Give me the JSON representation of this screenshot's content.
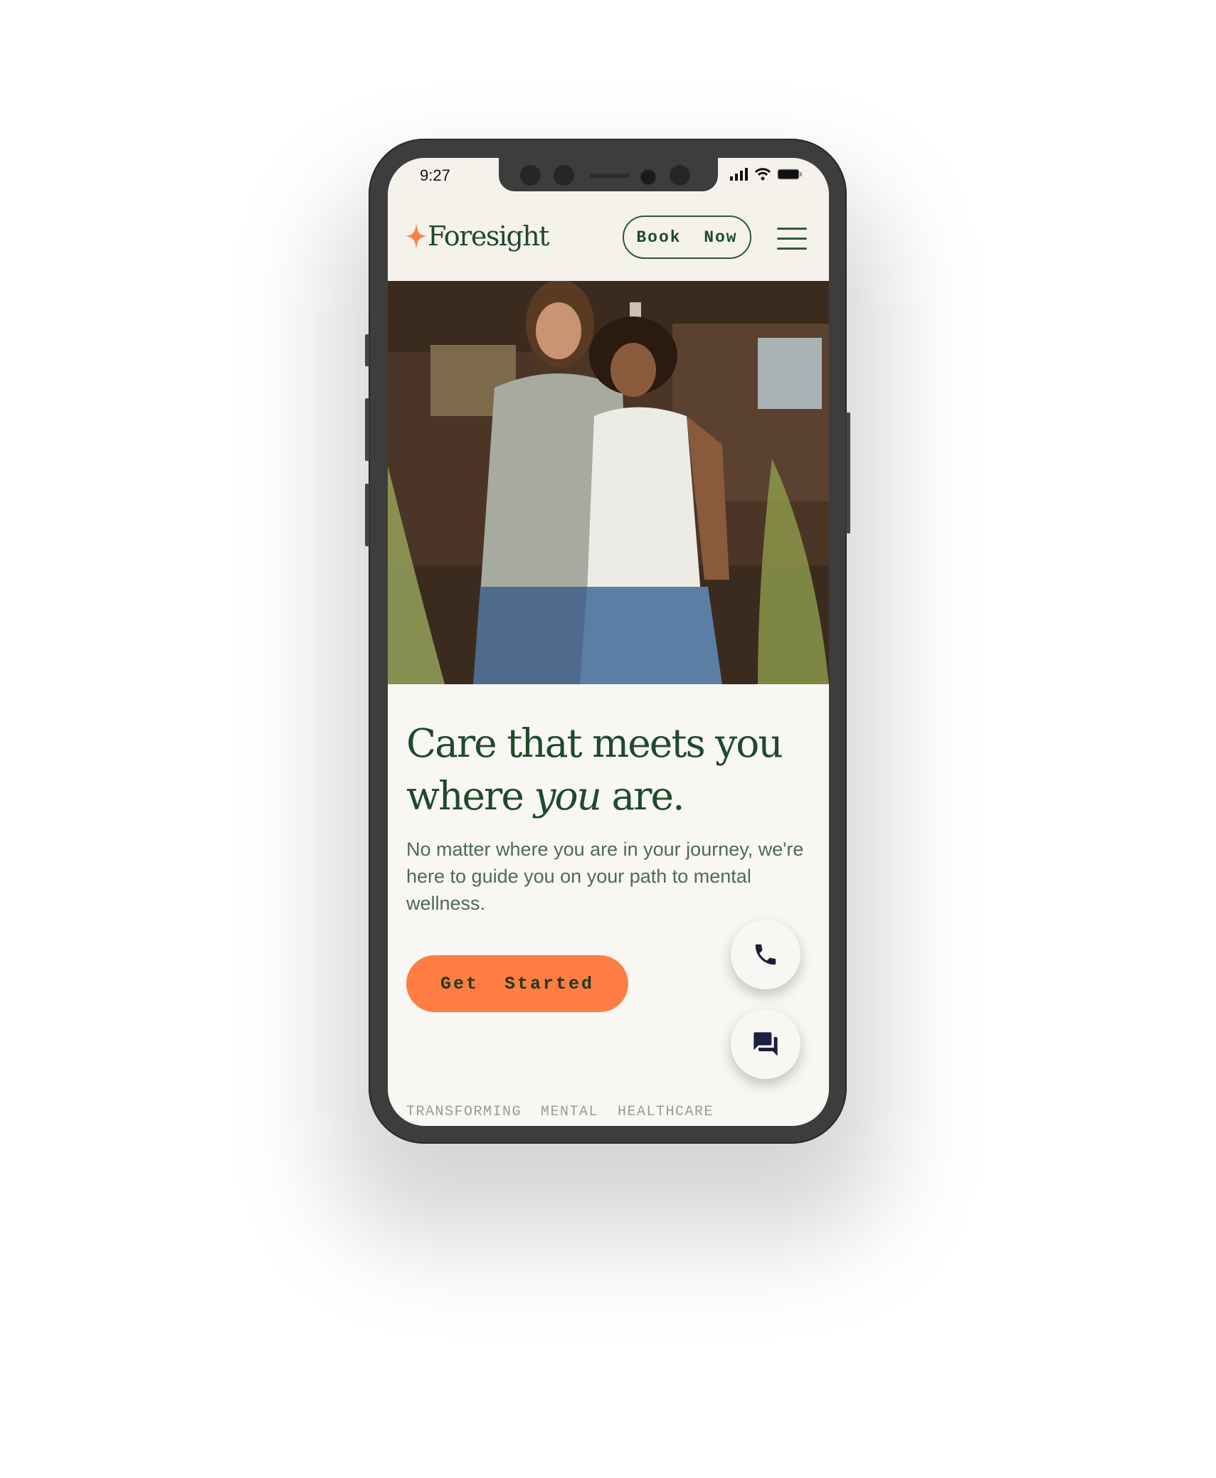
{
  "status_bar": {
    "time": "9:27"
  },
  "header": {
    "logo_text": "Foresight",
    "book_now_label": "Book  Now",
    "menu_icon": "hamburger-icon"
  },
  "hero": {
    "image_alt": "Smiling couple standing outdoors in front of a wooden house",
    "headline_line1": "Care that meets you",
    "headline_line2_before": "where ",
    "headline_line2_italic": "you",
    "headline_line2_after": " are.",
    "paragraph": "No matter where you are in your journey, we're here to guide you on your path to mental wellness.",
    "cta_label": "Get  Started"
  },
  "floating_actions": {
    "call_icon": "phone-icon",
    "chat_icon": "chat-icon"
  },
  "tagline": "TRANSFORMING  MENTAL  HEALTHCARE",
  "colors": {
    "brand_green": "#1f4a2b",
    "accent_orange": "#ff7d42",
    "background": "#f8f7f3",
    "icon_navy": "#1c1f3f"
  }
}
